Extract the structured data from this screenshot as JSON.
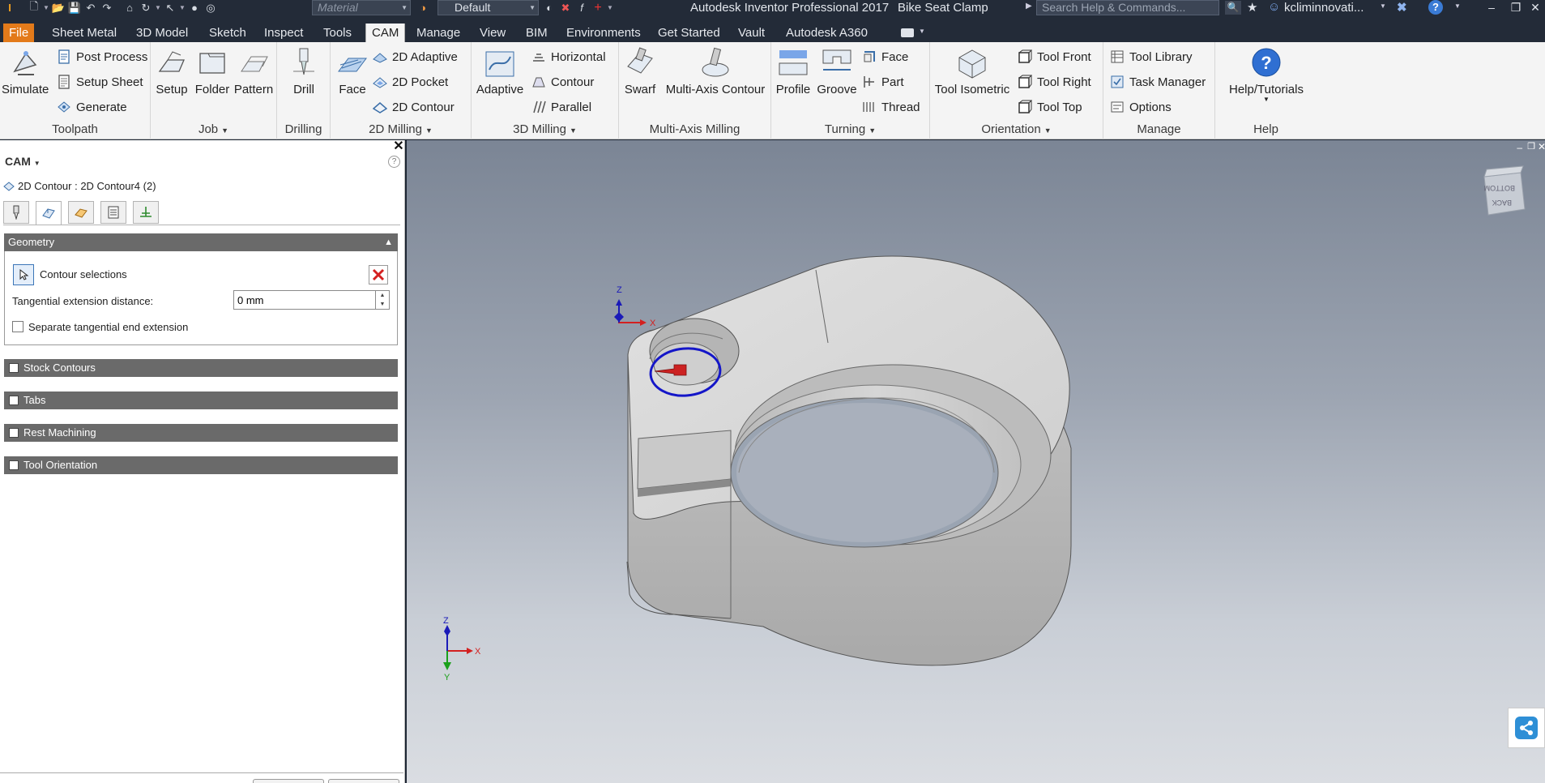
{
  "titlebar": {
    "app_title": "Autodesk Inventor Professional 2017",
    "document_title": "Bike Seat Clamp",
    "material_placeholder": "Material",
    "appearance_value": "Default",
    "search_placeholder": "Search Help & Commands...",
    "user_name": "kcliminnovati..."
  },
  "tabs": [
    "File",
    "Sheet Metal",
    "3D Model",
    "Sketch",
    "Inspect",
    "Tools",
    "CAM",
    "Manage",
    "View",
    "BIM",
    "Environments",
    "Get Started",
    "Vault",
    "Autodesk A360"
  ],
  "active_tab": "CAM",
  "ribbon": {
    "toolpath": {
      "label": "Toolpath",
      "simulate": "Simulate",
      "post_process": "Post Process",
      "setup_sheet": "Setup Sheet",
      "generate": "Generate"
    },
    "job": {
      "label": "Job",
      "setup": "Setup",
      "folder": "Folder",
      "pattern": "Pattern"
    },
    "drilling": {
      "label": "Drilling",
      "drill": "Drill"
    },
    "milling2d": {
      "label": "2D Milling",
      "face": "Face",
      "adaptive": "2D Adaptive",
      "pocket": "2D Pocket",
      "contour": "2D Contour"
    },
    "milling3d": {
      "label": "3D Milling",
      "adaptive": "Adaptive",
      "horizontal": "Horizontal",
      "contour": "Contour",
      "parallel": "Parallel"
    },
    "multiaxis": {
      "label": "Multi-Axis Milling",
      "swarf": "Swarf",
      "multi_axis_contour": "Multi-Axis Contour"
    },
    "turning": {
      "label": "Turning",
      "profile": "Profile",
      "groove": "Groove",
      "face": "Face",
      "part": "Part",
      "thread": "Thread"
    },
    "orientation": {
      "label": "Orientation",
      "tool_isometric": "Tool Isometric",
      "tool_front": "Tool Front",
      "tool_right": "Tool Right",
      "tool_top": "Tool Top"
    },
    "manage": {
      "label": "Manage",
      "tool_library": "Tool Library",
      "task_manager": "Task Manager",
      "options": "Options"
    },
    "help": {
      "label": "Help",
      "help_tutorials": "Help/Tutorials"
    }
  },
  "panel": {
    "header": "CAM",
    "operation_path": "2D Contour : 2D Contour4 (2)",
    "geometry": {
      "title": "Geometry",
      "contour_selections": "Contour selections",
      "tangential_label": "Tangential extension distance:",
      "tangential_value": "0 mm",
      "separate_label": "Separate tangential end extension",
      "separate_checked": false
    },
    "sections": [
      "Stock Contours",
      "Tabs",
      "Rest Machining",
      "Tool Orientation"
    ]
  },
  "viewport": {
    "viewcube_labels": [
      "BOTTOM",
      "BACK"
    ],
    "triad_labels": {
      "x": "X",
      "z": "Z",
      "y": "Y"
    },
    "colors": {
      "x_axis": "#d32020",
      "z_axis": "#1a1ab8",
      "y_axis": "#1aa01a",
      "selection": "#1416c8",
      "part": "#d4d4d4"
    }
  }
}
